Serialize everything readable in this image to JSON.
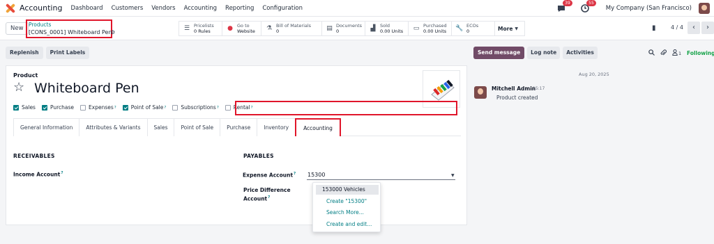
{
  "app": {
    "name": "Accounting"
  },
  "nav": {
    "items": [
      "Dashboard",
      "Customers",
      "Vendors",
      "Accounting",
      "Reporting",
      "Configuration"
    ],
    "chat_badge": "39",
    "activity_badge": "55",
    "company": "My Company (San Francisco)"
  },
  "control": {
    "new_label": "New",
    "breadcrumb_parent": "Products",
    "breadcrumb_current": "[CONS_0001] Whiteboard Pen",
    "smart_buttons": [
      {
        "icon": "list-icon",
        "title": "Pricelists",
        "value": "0 Rules"
      },
      {
        "icon": "globe-icon",
        "title": "Go to",
        "value": "Website"
      },
      {
        "icon": "flask-icon",
        "title": "Bill of Materials",
        "value": "0"
      },
      {
        "icon": "document-icon",
        "title": "Documents",
        "value": "0"
      },
      {
        "icon": "bar-chart-icon",
        "title": "Sold",
        "value": "0.00 Units"
      },
      {
        "icon": "credit-card-icon",
        "title": "Purchased",
        "value": "0.00 Units"
      },
      {
        "icon": "wrench-icon",
        "title": "ECOs",
        "value": "0"
      }
    ],
    "more_label": "More",
    "pager": "4 / 4"
  },
  "actions": {
    "replenish": "Replenish",
    "print_labels": "Print Labels"
  },
  "product": {
    "label": "Product",
    "name": "Whiteboard Pen",
    "checkboxes": [
      {
        "label": "Sales",
        "checked": true,
        "help": false
      },
      {
        "label": "Purchase",
        "checked": true,
        "help": false
      },
      {
        "label": "Expenses",
        "checked": false,
        "help": true
      },
      {
        "label": "Point of Sale",
        "checked": true,
        "help": true
      },
      {
        "label": "Subscriptions",
        "checked": false,
        "help": true
      },
      {
        "label": "Rental",
        "checked": false,
        "help": true
      }
    ],
    "help_mark": "?"
  },
  "tabs": [
    "General Information",
    "Attributes & Variants",
    "Sales",
    "Point of Sale",
    "Purchase",
    "Inventory",
    "Accounting"
  ],
  "active_tab": "Accounting",
  "accounting": {
    "receivables_title": "RECEIVABLES",
    "income_account_label": "Income Account",
    "payables_title": "PAYABLES",
    "expense_account_label": "Expense Account",
    "expense_account_value": "15300",
    "price_diff_label_1": "Price Difference",
    "price_diff_label_2": "Account",
    "dropdown": [
      "153000 Vehicles",
      "Create \"15300\"",
      "Search More...",
      "Create and edit..."
    ]
  },
  "chatter": {
    "send_message": "Send message",
    "log_note": "Log note",
    "activities": "Activities",
    "follower_count": "1",
    "following": "Following",
    "date": "Aug 20, 2025",
    "author": "Mitchell Admin",
    "time": "15:17",
    "body": "Product created"
  },
  "colors": {
    "brand": "#714b67",
    "accent": "#017e84",
    "highlight": "#e0152a",
    "following": "#16a34a"
  }
}
